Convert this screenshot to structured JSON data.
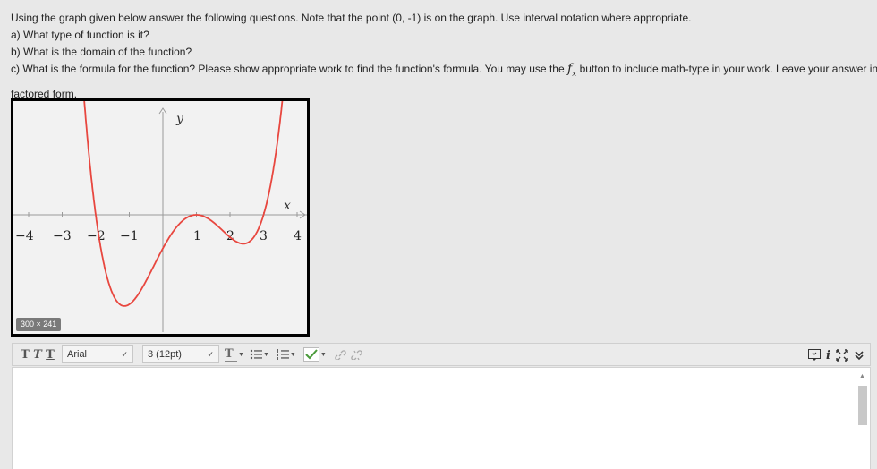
{
  "question": {
    "line1": "Using the graph given below answer the following questions. Note that the point (0, -1) is on the graph. Use interval notation where appropriate.",
    "line2": "a) What type of function is it?",
    "line3": "b) What is the domain of the function?",
    "line4_before": "c) What is the formula for the function? Please show appropriate work to find the function's formula. You may use the",
    "fx_f": "f",
    "fx_x": "x",
    "line4_after": "button to include math-type in your work. Leave your answer in",
    "line5": "factored form."
  },
  "graph": {
    "y_label": "y",
    "x_label": "x",
    "x_ticks": [
      "−4",
      "−3",
      "−2",
      "−1",
      "1",
      "2",
      "3",
      "4"
    ],
    "size_badge": "300 × 241",
    "curve_color": "#e8473f"
  },
  "toolbar": {
    "bold_icon": "T",
    "italic_icon": "T",
    "underline_icon": "T",
    "font_family": "Arial",
    "font_size": "3 (12pt)",
    "text_color_icon": "T"
  }
}
